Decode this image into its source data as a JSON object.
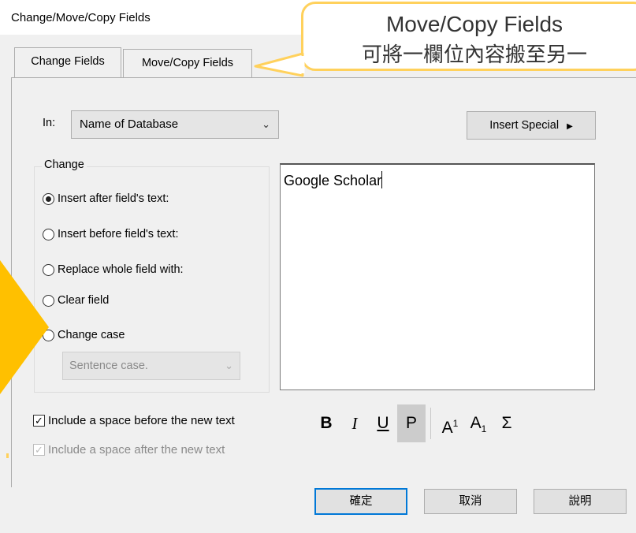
{
  "window": {
    "title": "Change/Move/Copy Fields"
  },
  "tabs": [
    {
      "label": "Change Fields",
      "active": true
    },
    {
      "label": "Move/Copy Fields",
      "active": false
    }
  ],
  "callout": {
    "line1": "Move/Copy Fields",
    "line2": "可將一欄位內容搬至另一",
    "border_color": "#ffd15c"
  },
  "in_field": {
    "label": "In:",
    "value": "Name of Database"
  },
  "insert_special": {
    "label": "Insert Special",
    "icon": "triangle-right-icon"
  },
  "change_group": {
    "legend": "Change",
    "options": [
      {
        "label": "Insert after field's text:",
        "selected": true
      },
      {
        "label": "Insert before field's text:",
        "selected": false
      },
      {
        "label": "Replace whole field with:",
        "selected": false
      },
      {
        "label": "Clear field",
        "selected": false
      },
      {
        "label": "Change case",
        "selected": false
      }
    ],
    "case_select": {
      "value": "Sentence case.",
      "enabled": false
    }
  },
  "text_value": "Google Scholar",
  "checkboxes": [
    {
      "label": "Include a space before the new text",
      "checked": true,
      "enabled": true
    },
    {
      "label": "Include a space after the new text",
      "checked": true,
      "enabled": false
    }
  ],
  "format_bar": {
    "bold": "B",
    "italic": "I",
    "underline": "U",
    "plain": "P",
    "superscript": "A",
    "superscript_mark": "1",
    "subscript": "A",
    "subscript_mark": "1",
    "symbol": "Σ"
  },
  "buttons": {
    "ok": "確定",
    "cancel": "取消",
    "help": "說明"
  },
  "colors": {
    "accent": "#0078d7",
    "highlight": "#ffc000"
  }
}
